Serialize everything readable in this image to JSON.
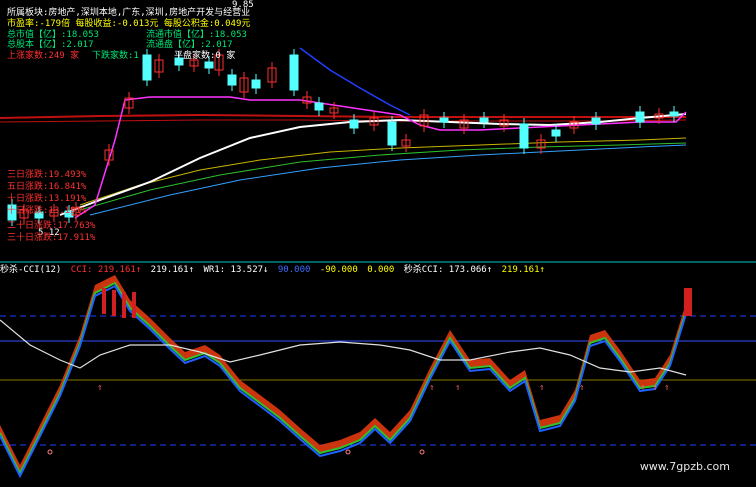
{
  "info_panel": {
    "sector_line": "所属板块:房地产,深圳本地,广东,深圳,房地产开发与经营业",
    "pe_line": "市盈率:-179倍  每股收益:-0.013元  每股公积金:0.049元",
    "mcap": "总市值【亿】:18.053",
    "float_mcap": "流通市值【亿】:18.053",
    "shares": "总股本【亿】:2.017",
    "float_shares": "流通盘【亿】:2.017",
    "up_count": "上涨家数:249 家",
    "down_count": "下跌家数:1",
    "flat_count": "平盘家数:0 家",
    "top_price": "9.85",
    "low_price": "5.12"
  },
  "returns": {
    "r3": "三日涨跌:19.493%",
    "r5": "五日涨跌:16.841%",
    "r10": "十日涨跌:13.191%",
    "r20": "二十日涨跌:17.763%",
    "r30": "三十日涨跌:17.911%"
  },
  "indicator_bar": {
    "name": "秒杀-CCI(12)",
    "cci_label": "CCI: 219.161↑",
    "cci_val": "219.161↑",
    "wr1": "WR1: 13.527↓",
    "ref1": "90.000",
    "ref2": "-90.000",
    "ref3": "0.000",
    "ms_cci": "秒杀CCI: 173.066↑",
    "ms_val": "219.161↑"
  },
  "watermark": "www.7gpzb.com",
  "colors": {
    "up": "#ff3030",
    "down": "#54ffff",
    "ma_white": "#ffffff",
    "ma_yellow": "#c8b400",
    "ma_green": "#2dbf2d",
    "ma_cyan": "#33a0ff",
    "ma_red": "#c01010",
    "magenta": "#ff33ff",
    "blue": "#2040ff"
  }
}
